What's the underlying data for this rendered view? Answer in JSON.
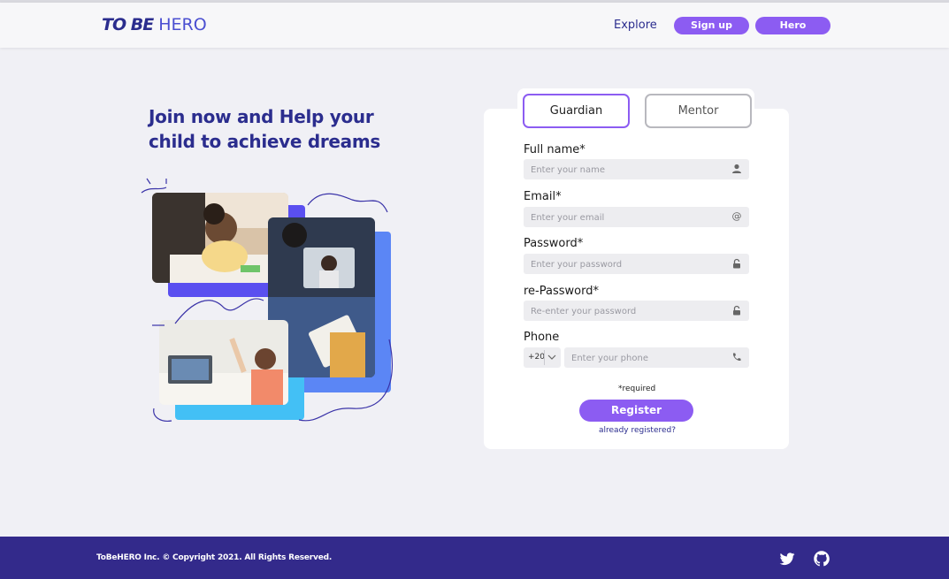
{
  "header": {
    "logo_tobe": "TO BE",
    "logo_hero": "HERO",
    "nav": {
      "explore": "Explore",
      "signup": "Sign up",
      "hero": "Hero"
    }
  },
  "hero": {
    "headline": "Join now and Help your child to achieve dreams"
  },
  "form": {
    "tabs": {
      "guardian": "Guardian",
      "mentor": "Mentor"
    },
    "fields": {
      "fullname": {
        "label": "Full name*",
        "placeholder": "Enter your name",
        "icon": "user-icon"
      },
      "email": {
        "label": "Email*",
        "placeholder": "Enter your email",
        "icon": "at-icon"
      },
      "password": {
        "label": "Password*",
        "placeholder": "Enter your password",
        "icon": "lock-icon"
      },
      "repassword": {
        "label": "re-Password*",
        "placeholder": "Re-enter your password",
        "icon": "lock-icon"
      },
      "phone": {
        "label": "Phone",
        "country_code": "+20",
        "placeholder": "Enter your phone",
        "icon": "phone-icon"
      }
    },
    "required_note": "*required",
    "register_label": "Register",
    "already_link": "already registered?"
  },
  "footer": {
    "copyright": "ToBeHERO  Inc. © Copyright 2021. All Rights Reserved.",
    "social": [
      "twitter-icon",
      "github-icon"
    ]
  },
  "colors": {
    "primary_purple": "#8c5cf2",
    "navy": "#2b2d8e",
    "footer_bg": "#332a8b",
    "page_bg": "#f0f0f5"
  }
}
